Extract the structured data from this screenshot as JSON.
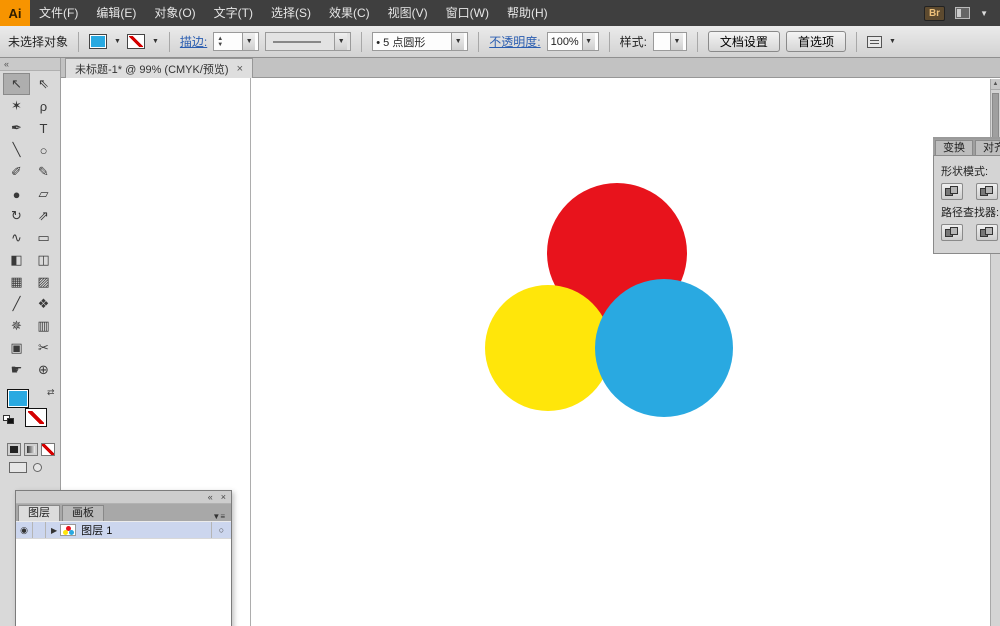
{
  "ui": {
    "caret": "▼",
    "spin_up": "▲",
    "spin_down": "▼"
  },
  "app": {
    "logo_text": "Ai"
  },
  "menubar": {
    "items": [
      {
        "label": "文件(F)"
      },
      {
        "label": "编辑(E)"
      },
      {
        "label": "对象(O)"
      },
      {
        "label": "文字(T)"
      },
      {
        "label": "选择(S)"
      },
      {
        "label": "效果(C)"
      },
      {
        "label": "视图(V)"
      },
      {
        "label": "窗口(W)"
      },
      {
        "label": "帮助(H)"
      }
    ],
    "bridge_label": "Br"
  },
  "controlbar": {
    "selection_status": "未选择对象",
    "fill_color": "#29a9e1",
    "stroke_label": "描边:",
    "brush_value": "• 5 点圆形",
    "opacity_label": "不透明度:",
    "opacity_value": "100%",
    "style_label": "样式:",
    "doc_setup_button": "文档设置",
    "preferences_button": "首选项"
  },
  "toolbar": {
    "collapse_glyph": "«",
    "fill_color": "#29a9e1",
    "tools": [
      {
        "name": "selection",
        "glyph": "↖"
      },
      {
        "name": "direct-selection",
        "glyph": "⇖"
      },
      {
        "name": "magic-wand",
        "glyph": "✶"
      },
      {
        "name": "lasso",
        "glyph": "ρ"
      },
      {
        "name": "pen",
        "glyph": "✒"
      },
      {
        "name": "type",
        "glyph": "T"
      },
      {
        "name": "line-segment",
        "glyph": "╲"
      },
      {
        "name": "ellipse",
        "glyph": "○"
      },
      {
        "name": "paintbrush",
        "glyph": "✐"
      },
      {
        "name": "pencil",
        "glyph": "✎"
      },
      {
        "name": "blob-brush",
        "glyph": "●"
      },
      {
        "name": "eraser",
        "glyph": "▱"
      },
      {
        "name": "rotate",
        "glyph": "↻"
      },
      {
        "name": "scale",
        "glyph": "⇗"
      },
      {
        "name": "width",
        "glyph": "∿"
      },
      {
        "name": "free-transform",
        "glyph": "▭"
      },
      {
        "name": "shape-builder",
        "glyph": "◧"
      },
      {
        "name": "perspective-grid",
        "glyph": "◫"
      },
      {
        "name": "mesh",
        "glyph": "▦"
      },
      {
        "name": "gradient",
        "glyph": "▨"
      },
      {
        "name": "eyedropper",
        "glyph": "╱"
      },
      {
        "name": "blend",
        "glyph": "❖"
      },
      {
        "name": "symbol-sprayer",
        "glyph": "✵"
      },
      {
        "name": "column-graph",
        "glyph": "▥"
      },
      {
        "name": "artboard",
        "glyph": "▣"
      },
      {
        "name": "slice",
        "glyph": "✂"
      },
      {
        "name": "hand",
        "glyph": "☛"
      },
      {
        "name": "zoom",
        "glyph": "⊕"
      }
    ]
  },
  "tabbar": {
    "document_title": "未标题-1* @ 99% (CMYK/预览)",
    "close_glyph": "×"
  },
  "canvas": {
    "circles": [
      {
        "label": "red-circle",
        "color": "#e8131c"
      },
      {
        "label": "yellow-circle",
        "color": "#ffe60a"
      },
      {
        "label": "blue-circle",
        "color": "#29a9e1"
      }
    ]
  },
  "pathfinder_panel": {
    "tabs": [
      {
        "label": "变换"
      },
      {
        "label": "对齐"
      }
    ],
    "shape_modes_label": "形状模式:",
    "pathfinder_label": "路径查找器:"
  },
  "layers_panel": {
    "collapse_glyph": "«",
    "close_glyph": "×",
    "menu_glyph": "▼≡",
    "tabs": [
      {
        "label": "图层"
      },
      {
        "label": "画板"
      }
    ],
    "rows": [
      {
        "name": "图层 1",
        "eye_glyph": "◉",
        "expand_glyph": "▶",
        "target_glyph": "○"
      }
    ]
  },
  "scrollbar": {
    "up_glyph": "▲"
  }
}
